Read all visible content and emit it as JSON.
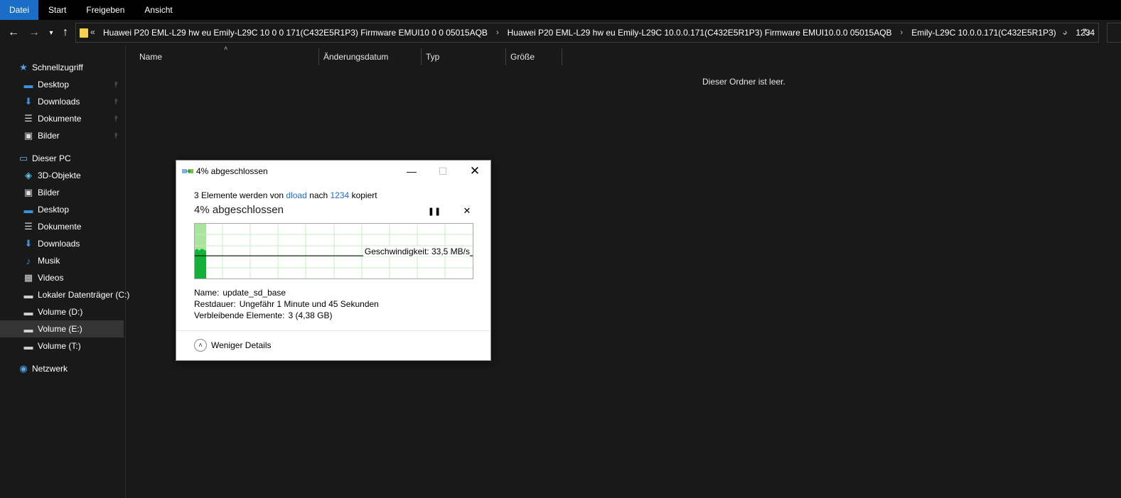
{
  "ribbon": {
    "tabs": [
      {
        "label": "Datei",
        "active": true
      },
      {
        "label": "Start",
        "active": false
      },
      {
        "label": "Freigeben",
        "active": false
      },
      {
        "label": "Ansicht",
        "active": false
      }
    ]
  },
  "address": {
    "crumbs": [
      "Huawei P20 EML-L29 hw eu Emily-L29C 10 0 0 171(C432E5R1P3) Firmware EMUI10 0 0 05015AQB",
      "Huawei P20 EML-L29 hw eu Emily-L29C 10.0.0.171(C432E5R1P3) Firmware EMUI10.0.0 05015AQB",
      "Emily-L29C 10.0.0.171(C432E5R1P3)",
      "1234"
    ]
  },
  "sidebar": {
    "items": [
      {
        "label": "Schnellzugriff",
        "icon": "star-icon",
        "level": 0,
        "pinned": false
      },
      {
        "label": "Desktop",
        "icon": "desktop-icon",
        "level": 1,
        "pinned": true
      },
      {
        "label": "Downloads",
        "icon": "download-icon",
        "level": 1,
        "pinned": true
      },
      {
        "label": "Dokumente",
        "icon": "document-icon",
        "level": 1,
        "pinned": true
      },
      {
        "label": "Bilder",
        "icon": "pictures-icon",
        "level": 1,
        "pinned": true
      },
      {
        "label": "Dieser PC",
        "icon": "computer-icon",
        "level": 0,
        "pinned": false
      },
      {
        "label": "3D-Objekte",
        "icon": "cube-icon",
        "level": 1,
        "pinned": false
      },
      {
        "label": "Bilder",
        "icon": "pictures-icon",
        "level": 1,
        "pinned": false
      },
      {
        "label": "Desktop",
        "icon": "desktop-icon",
        "level": 1,
        "pinned": false
      },
      {
        "label": "Dokumente",
        "icon": "document-icon",
        "level": 1,
        "pinned": false
      },
      {
        "label": "Downloads",
        "icon": "download-icon",
        "level": 1,
        "pinned": false
      },
      {
        "label": "Musik",
        "icon": "music-icon",
        "level": 1,
        "pinned": false
      },
      {
        "label": "Videos",
        "icon": "video-icon",
        "level": 1,
        "pinned": false
      },
      {
        "label": "Lokaler Datenträger (C:)",
        "icon": "drive-icon",
        "level": 1,
        "pinned": false
      },
      {
        "label": "Volume (D:)",
        "icon": "drive-icon",
        "level": 1,
        "pinned": false
      },
      {
        "label": "Volume (E:)",
        "icon": "drive-icon",
        "level": 1,
        "pinned": false,
        "selected": true
      },
      {
        "label": "Volume (T:)",
        "icon": "drive-icon",
        "level": 1,
        "pinned": false
      },
      {
        "label": "Netzwerk",
        "icon": "network-icon",
        "level": 0,
        "pinned": false
      }
    ]
  },
  "columns": [
    "Name",
    "Änderungsdatum",
    "Typ",
    "Größe"
  ],
  "main": {
    "empty_message": "Dieser Ordner ist leer."
  },
  "dialog": {
    "title": "4% abgeschlossen",
    "summary_prefix": "3 Elemente werden von",
    "source": "dload",
    "summary_mid": "nach",
    "destination": "1234",
    "summary_suffix": "kopiert",
    "heading": "4% abgeschlossen",
    "progress_percent": 4,
    "speed_label": "Geschwindigkeit: 33,5 MB/s",
    "name_label": "Name:",
    "name_value": "update_sd_base",
    "remaining_label": "Restdauer:",
    "remaining_value": "Ungefähr 1 Minute und 45 Sekunden",
    "items_label": "Verbleibende Elemente:",
    "items_value": "3 (4,38 GB)",
    "details_label": "Weniger Details"
  },
  "colors": {
    "accent": "#1a6ec7",
    "graph_fill": "#13b03a",
    "graph_progress": "#a7e59d",
    "graph_grid": "#c6ecc4",
    "folder": "#f4d24e"
  }
}
